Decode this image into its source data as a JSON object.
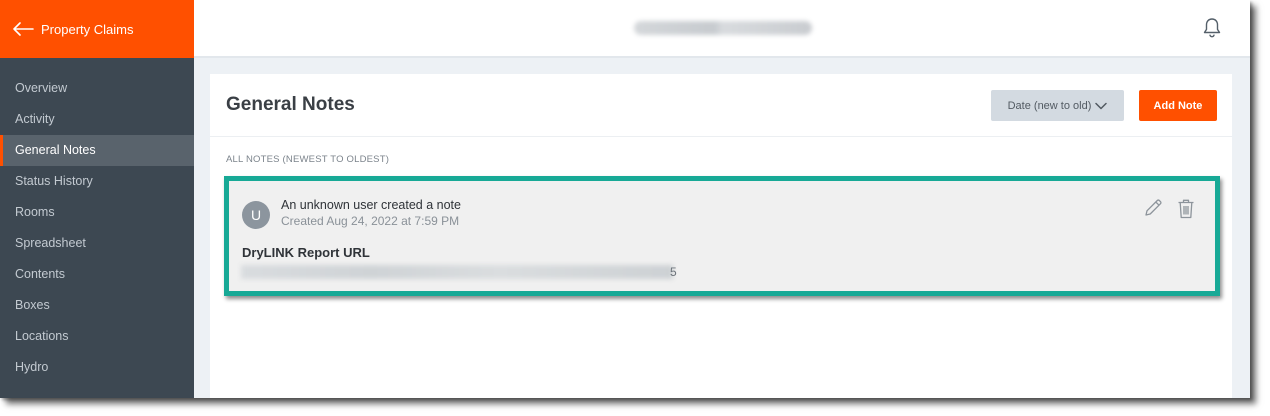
{
  "sidebar": {
    "header_label": "Property Claims",
    "back_icon": "arrow-left-icon",
    "items": [
      {
        "label": "Overview"
      },
      {
        "label": "Activity"
      },
      {
        "label": "General Notes",
        "active": true
      },
      {
        "label": "Status History"
      },
      {
        "label": "Rooms"
      },
      {
        "label": "Spreadsheet"
      },
      {
        "label": "Contents"
      },
      {
        "label": "Boxes"
      },
      {
        "label": "Locations"
      },
      {
        "label": "Hydro"
      }
    ]
  },
  "topbar": {
    "notification_icon": "bell-icon"
  },
  "main": {
    "title": "General Notes",
    "sort_label": "Date (new to old)",
    "add_note_label": "Add Note",
    "section_label": "ALL NOTES (NEWEST TO OLDEST)",
    "notes": [
      {
        "avatar_initial": "U",
        "author_text": "An unknown user created a note",
        "created_text": "Created Aug 24, 2022 at 7:59 PM",
        "title": "DryLINK Report URL",
        "url_tail": "5"
      }
    ]
  },
  "colors": {
    "brand_orange": "#ff5000",
    "sidebar_bg": "#3d4852",
    "highlight_teal": "#17a996"
  }
}
